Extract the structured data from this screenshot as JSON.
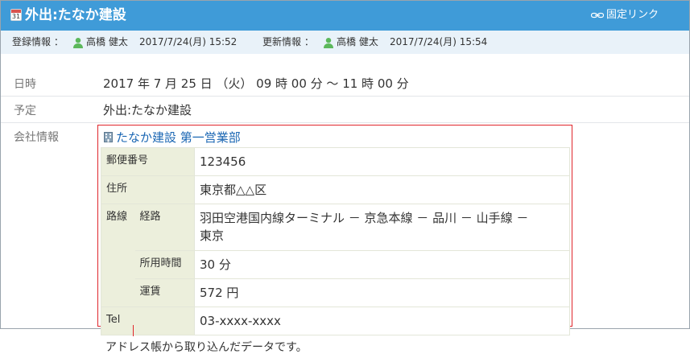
{
  "header": {
    "calendar_icon_number": "31",
    "title": "外出:たなか建設",
    "fixed_link": "固定リンク"
  },
  "meta": {
    "registered_label": "登録情報 ：",
    "registered_user": "高橋 健太",
    "registered_datetime": "2017/7/24(月) 15:52",
    "updated_label": "更新情報 ：",
    "updated_user": "高橋 健太",
    "updated_datetime": "2017/7/24(月) 15:54"
  },
  "rows": {
    "datetime_label": "日時",
    "datetime_value": "2017 年 7 月 25 日 （火） 09 時 00 分 ～ 11 時 00 分",
    "plan_label": "予定",
    "plan_value": "外出:たなか建設",
    "company_label": "会社情報"
  },
  "company": {
    "name": "たなか建設 第一営業部",
    "postal_label": "郵便番号",
    "postal_value": "123456",
    "address_label": "住所",
    "address_value": "東京都△△区",
    "route_label": "路線",
    "route_sub_label": "経路",
    "route_value_line1": "羽田空港国内線ターミナル － 京急本線 － 品川 － 山手線 －",
    "route_value_line2": "東京",
    "duration_label": "所用時間",
    "duration_value": "30 分",
    "fare_label": "運賃",
    "fare_value": "572 円",
    "tel_label": "Tel",
    "tel_value": "03-xxxx-xxxx"
  },
  "caption": "アドレス帳から取り込んだデータです。",
  "colors": {
    "header_bg": "#3f9bd8",
    "meta_bg": "#e9f2f9",
    "label_cell_bg": "#ecefdc",
    "highlight_border": "#e0262b",
    "link": "#1a66b3"
  }
}
